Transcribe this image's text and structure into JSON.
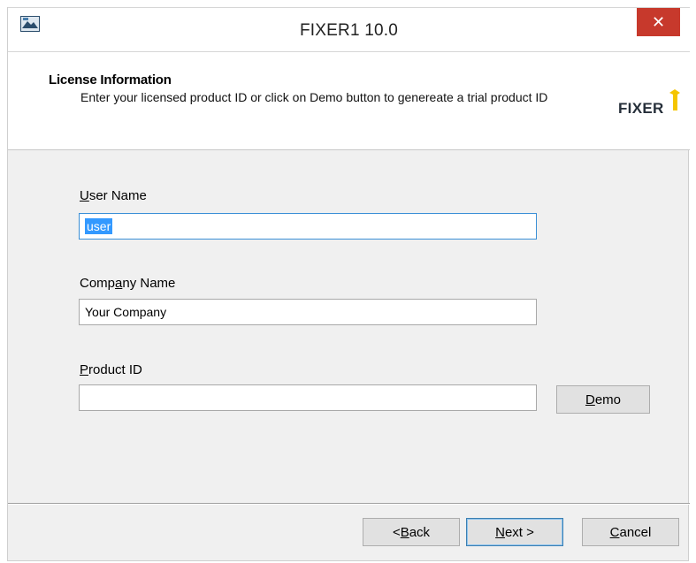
{
  "window": {
    "title": "FIXER1 10.0",
    "close_icon": "close-icon",
    "app_icon": "setup-icon"
  },
  "header": {
    "title": "License Information",
    "description": "Enter your licensed product ID or click on Demo button to genereate a trial product ID",
    "logo": {
      "text": "FIXER",
      "accent_color": "#f5c500"
    }
  },
  "form": {
    "user_name": {
      "label_pre": "",
      "label_key": "U",
      "label_post": "ser Name",
      "value": "user"
    },
    "company_name": {
      "label_pre": "Comp",
      "label_key": "a",
      "label_post": "ny Name",
      "value": "Your Company"
    },
    "product_id": {
      "label_pre": "",
      "label_key": "P",
      "label_post": "roduct ID",
      "value": ""
    },
    "demo_button": {
      "label_pre": "",
      "label_key": "D",
      "label_post": "emo"
    }
  },
  "footer": {
    "back": {
      "label_pre": "< ",
      "label_key": "B",
      "label_post": "ack"
    },
    "next": {
      "label_pre": "",
      "label_key": "N",
      "label_post": "ext >"
    },
    "cancel": {
      "label_pre": "",
      "label_key": "C",
      "label_post": "ancel"
    }
  },
  "colors": {
    "close_button": "#c7392c",
    "selection": "#3399ff",
    "focus_border": "#3a8fd6",
    "dialog_bg": "#f0f0f0"
  }
}
